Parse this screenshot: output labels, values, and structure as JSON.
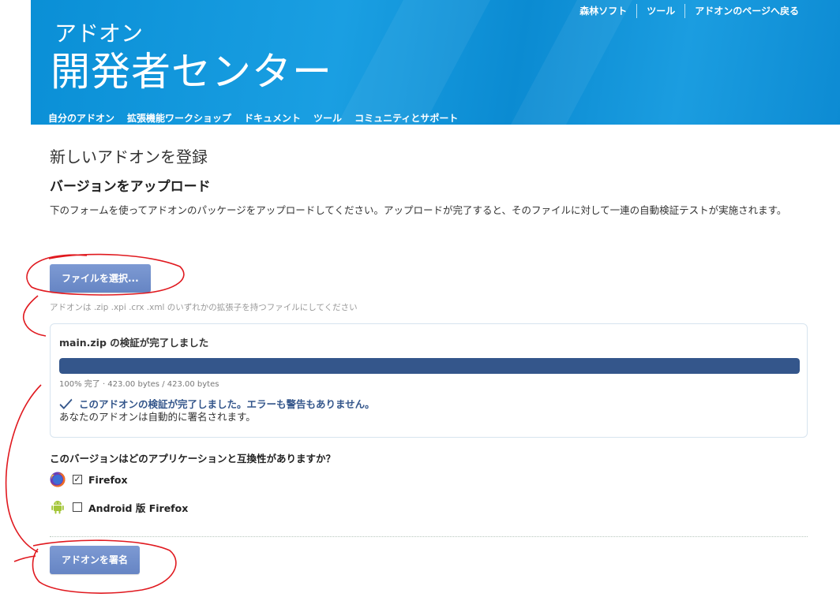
{
  "header": {
    "top_links": [
      "森林ソフト",
      "ツール",
      "アドオンのページへ戻る"
    ],
    "brand_sub": "アドオン",
    "brand_main": "開発者センター",
    "nav": [
      "自分のアドオン",
      "拡張機能ワークショップ",
      "ドキュメント",
      "ツール",
      "コミュニティとサポート"
    ],
    "bg_color": "#0a8fd6"
  },
  "page": {
    "title": "新しいアドオンを登録",
    "section_title": "バージョンをアップロード",
    "description": "下のフォームを使ってアドオンのパッケージをアップロードしてください。アップロードが完了すると、そのファイルに対して一連の自動検証テストが実施されます。"
  },
  "upload": {
    "file_button": "ファイルを選択...",
    "hint": "アドオンは .zip .xpi .crx .xml のいずれかの拡張子を持つファイルにしてください"
  },
  "validation": {
    "title": "main.zip の検証が完了しました",
    "progress_percent": 100,
    "progress_text": "100% 完了 · 423.00 bytes / 423.00 bytes",
    "success_message": "このアドオンの検証が完了しました。エラーも警告もありません。",
    "sub_message": "あなたのアドオンは自動的に署名されます。",
    "accent_color": "#34568b"
  },
  "compat": {
    "question": "このバージョンはどのアプリケーションと互換性がありますか？",
    "apps": [
      {
        "label": "Firefox",
        "checked": true,
        "icon": "firefox-icon"
      },
      {
        "label": "Android 版 Firefox",
        "checked": false,
        "icon": "android-icon"
      }
    ]
  },
  "actions": {
    "sign_button": "アドオンを署名"
  }
}
